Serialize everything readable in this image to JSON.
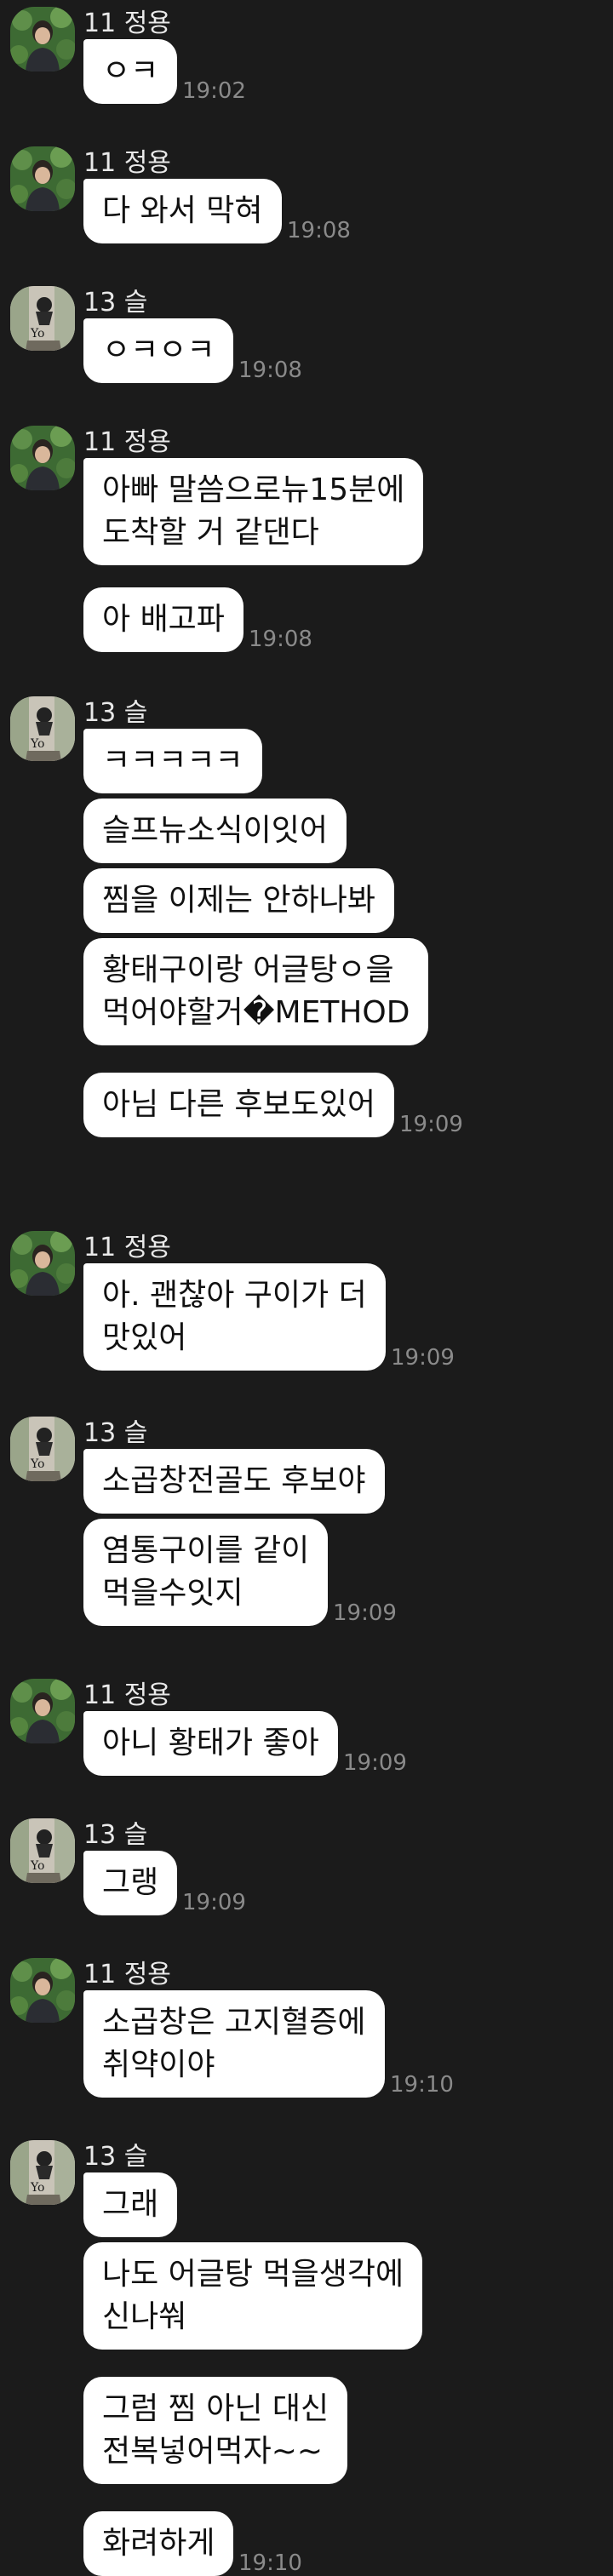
{
  "chat": {
    "groups": [
      {
        "sender": "11 정용",
        "avatar": "avatar-jungyong-icon",
        "messages": [
          {
            "text": "ㅇㅋ",
            "time": "19:02"
          }
        ]
      },
      {
        "sender": "11 정용",
        "avatar": "avatar-jungyong-icon",
        "messages": [
          {
            "text": "다 와서 막혀",
            "time": "19:08"
          }
        ]
      },
      {
        "sender": "13 슬",
        "avatar": "avatar-seul-icon",
        "messages": [
          {
            "text": "ㅇㅋㅇㅋ",
            "time": "19:08"
          }
        ]
      },
      {
        "sender": "11 정용",
        "avatar": "avatar-jungyong-icon",
        "messages": [
          {
            "text": "아빠 말씀으로뉴15분에\n도착할 거 같댄다",
            "time": ""
          },
          {
            "text": "아 배고파",
            "time": "19:08"
          }
        ]
      },
      {
        "sender": "13 슬",
        "avatar": "avatar-seul-icon",
        "messages": [
          {
            "text": "ㅋㅋㅋㅋㅋ",
            "time": ""
          },
          {
            "text": "슬프뉴소식이잇어",
            "time": ""
          },
          {
            "text": "찜을 이제는 안하나봐",
            "time": ""
          },
          {
            "text": "황태구이랑 어글탕ㅇ을\n먹어야할거�METHOD",
            "time": ""
          },
          {
            "text": "아님 다른 후보도있어",
            "time": "19:09"
          }
        ]
      },
      {
        "sender": "11 정용",
        "avatar": "avatar-jungyong-icon",
        "messages": [
          {
            "text": "아. 괜찮아 구이가 더\n맛있어",
            "time": "19:09"
          }
        ]
      },
      {
        "sender": "13 슬",
        "avatar": "avatar-seul-icon",
        "messages": [
          {
            "text": "소곱창전골도 후보야",
            "time": ""
          },
          {
            "text": "염통구이를 같이\n먹을수잇지",
            "time": "19:09"
          }
        ]
      },
      {
        "sender": "11 정용",
        "avatar": "avatar-jungyong-icon",
        "messages": [
          {
            "text": "아니 황태가 좋아",
            "time": "19:09"
          }
        ]
      },
      {
        "sender": "13 슬",
        "avatar": "avatar-seul-icon",
        "messages": [
          {
            "text": "그랭",
            "time": "19:09"
          }
        ]
      },
      {
        "sender": "11 정용",
        "avatar": "avatar-jungyong-icon",
        "messages": [
          {
            "text": "소곱창은 고지혈증에\n취약이야",
            "time": "19:10"
          }
        ]
      },
      {
        "sender": "13 슬",
        "avatar": "avatar-seul-icon",
        "messages": [
          {
            "text": "그래",
            "time": ""
          },
          {
            "text": "나도 어글탕 먹을생각에\n신나쒀",
            "time": ""
          },
          {
            "text": "그럼 찜 아닌 대신\n전복넣어먹자~~",
            "time": ""
          },
          {
            "text": "화려하게",
            "time": "19:10"
          }
        ]
      }
    ]
  }
}
